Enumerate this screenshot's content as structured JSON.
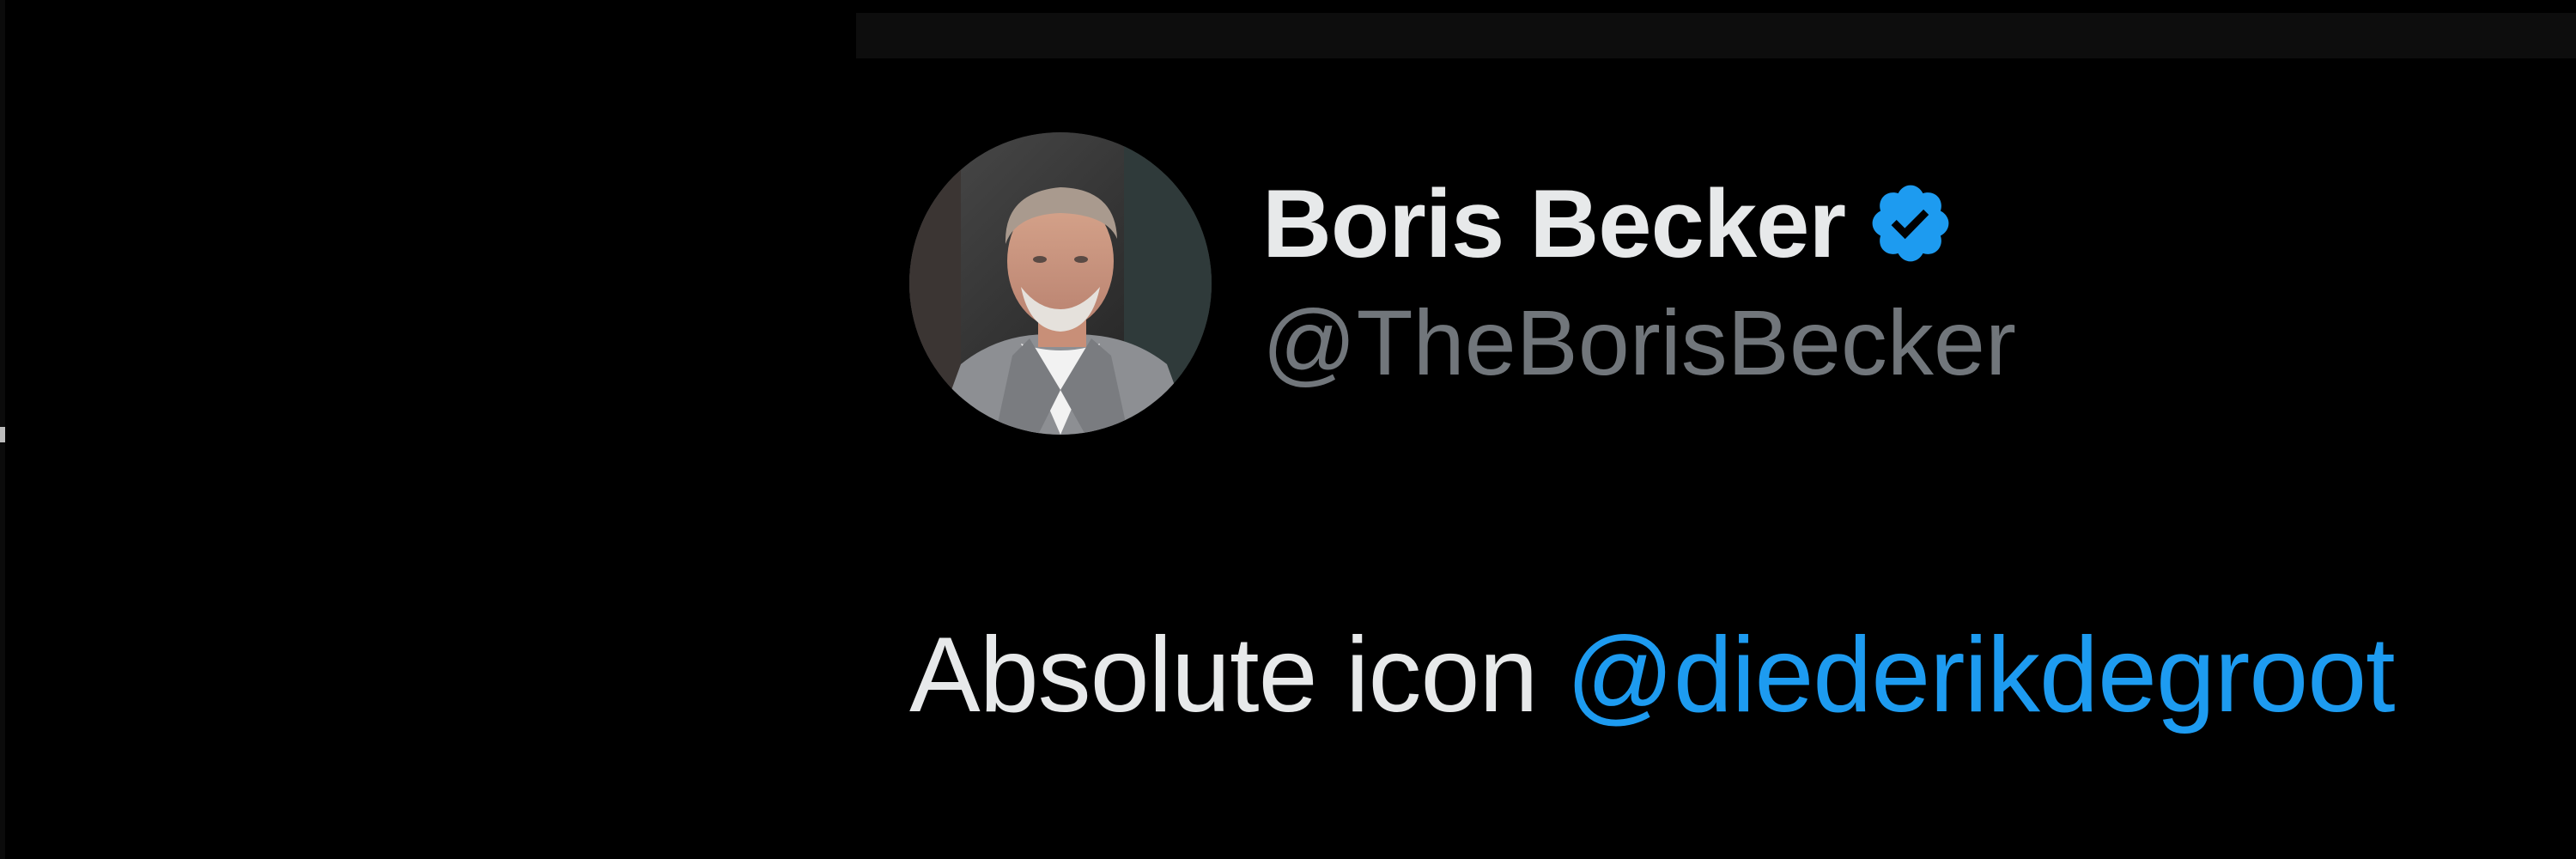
{
  "tweet": {
    "author": {
      "display_name": "Boris Becker",
      "handle": "@TheBorisBecker",
      "verified": true,
      "verified_icon": "verified-badge-icon",
      "verified_color": "#1d9bf0"
    },
    "text_prefix": "Absolute icon ",
    "mention": "@diederikdegroot"
  },
  "colors": {
    "background": "#000000",
    "name": "#e7e9ea",
    "handle": "#71767b",
    "link": "#1d9bf0"
  }
}
